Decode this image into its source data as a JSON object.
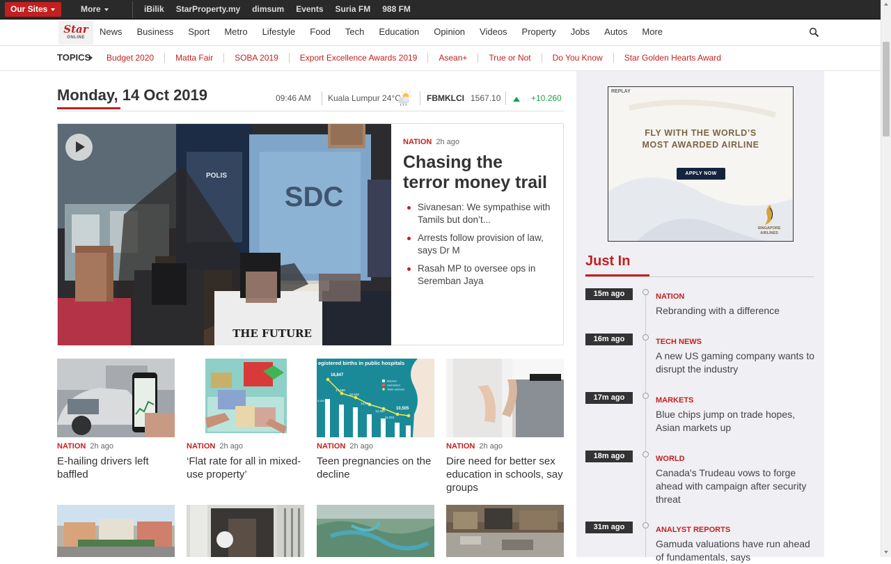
{
  "topbar": {
    "our_sites": "Our Sites",
    "more": "More",
    "links": [
      "iBilik",
      "StarProperty.my",
      "dimsum",
      "Events",
      "Suria FM",
      "988 FM"
    ]
  },
  "logo": {
    "word": "Star",
    "sub": "ONLINE"
  },
  "nav": {
    "items": [
      "News",
      "Business",
      "Sport",
      "Metro",
      "Lifestyle",
      "Food",
      "Tech",
      "Education",
      "Opinion",
      "Videos",
      "Property",
      "Jobs",
      "Autos",
      "More"
    ]
  },
  "topics": {
    "label": "TOPICS",
    "items": [
      "Budget 2020",
      "Matta Fair",
      "SOBA 2019",
      "Export Excellence Awards 2019",
      "Asean+",
      "True or Not",
      "Do You Know",
      "Star Golden Hearts Award"
    ]
  },
  "dateline": {
    "date": "Monday, 14 Oct 2019",
    "time": "09:46 AM",
    "weather": "Kuala Lumpur 24°C",
    "market_name": "FBMKLCI",
    "market_value": "1567.10",
    "market_change": "+10.260"
  },
  "hero": {
    "category": "NATION",
    "ago": "2h ago",
    "headline": "Chasing the terror money trail",
    "image_texts": {
      "shirt": "THE FUTURE",
      "vest": "POLIS",
      "tee": "SDC"
    },
    "bullets": [
      "Sivanesan: We sympathise with Tamils but don’t...",
      "Arrests follow provision of law, says Dr M",
      "Rasah MP to oversee ops in Seremban Jaya"
    ]
  },
  "stories": [
    {
      "category": "NATION",
      "ago": "2h ago",
      "headline": "E-hailing drivers left baffled"
    },
    {
      "category": "NATION",
      "ago": "2h ago",
      "headline": "‘Flat rate for all in mixed-use property’"
    },
    {
      "category": "NATION",
      "ago": "2h ago",
      "headline": "Teen pregnancies on the decline"
    },
    {
      "category": "NATION",
      "ago": "2h ago",
      "headline": "Dire need for better sex education in schools, say groups"
    }
  ],
  "births_chart": {
    "caption": "egistered births in public hospitals",
    "peak": "18,847",
    "points": [
      "17,588",
      "16,528",
      "13,831",
      "12,492",
      "11,024",
      "10,505"
    ],
    "legend": [
      "Married",
      "Unmarried",
      "Total numbers"
    ],
    "axis_tick": "5,000"
  },
  "ad": {
    "replay": "REPLAY",
    "headline_line1": "FLY WITH THE WORLD’S",
    "headline_line2": "MOST AWARDED AIRLINE",
    "button": "APPLY NOW",
    "brand_line1": "SINGAPORE",
    "brand_line2": "AIRLINES"
  },
  "just_in": {
    "title": "Just In",
    "items": [
      {
        "time": "15m ago",
        "category": "NATION",
        "headline": "Rebranding with a difference"
      },
      {
        "time": "16m ago",
        "category": "TECH NEWS",
        "headline": "A new US gaming company wants to disrupt the industry"
      },
      {
        "time": "17m ago",
        "category": "MARKETS",
        "headline": "Blue chips jump on trade hopes, Asian markets up"
      },
      {
        "time": "18m ago",
        "category": "WORLD",
        "headline": "Canada's Trudeau vows to forge ahead with campaign after security threat"
      },
      {
        "time": "31m ago",
        "category": "ANALYST REPORTS",
        "headline": "Gamuda valuations have run ahead of fundamentals, says"
      }
    ]
  },
  "colors": {
    "brand_red": "#c31f1f",
    "market_up": "#1e9e4a",
    "topbar": "#2a2a2a",
    "sidebar_bg": "#f0eff4"
  },
  "icons": {
    "search": "search-icon",
    "weather": "partly-cloudy-icon",
    "play": "play-icon",
    "market_up": "triangle-up-icon"
  }
}
